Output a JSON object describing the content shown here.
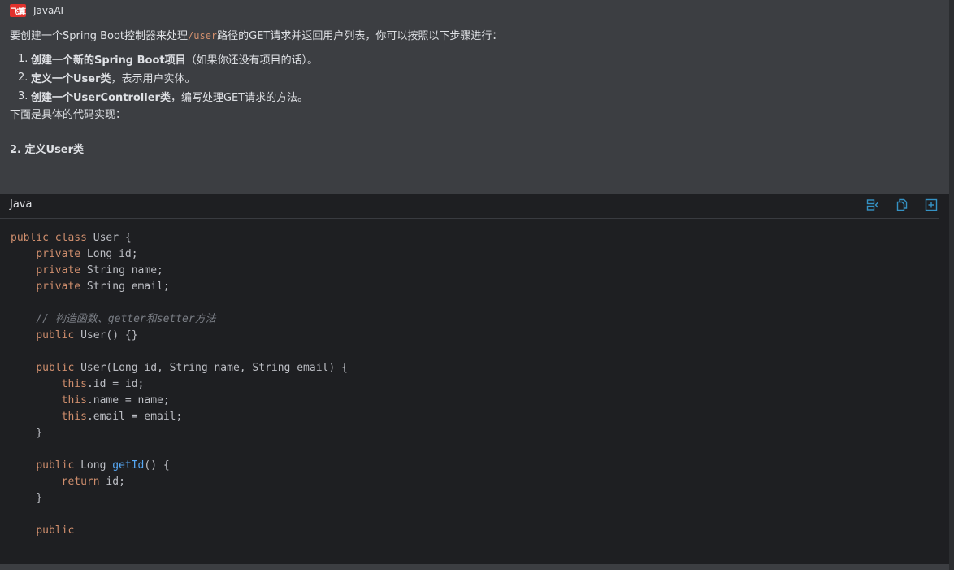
{
  "header": {
    "logo_text": "飞算",
    "app_name": "JavaAI"
  },
  "message": {
    "intro_before": "要创建一个Spring Boot控制器来处理",
    "intro_code": "/user",
    "intro_after": "路径的GET请求并返回用户列表，你可以按照以下步骤进行：",
    "steps": [
      {
        "num": "1.",
        "bold": "创建一个新的Spring Boot项目",
        "rest": "（如果你还没有项目的话）。"
      },
      {
        "num": "2.",
        "bold": "定义一个User类",
        "rest": "，表示用户实体。"
      },
      {
        "num": "3.",
        "bold": "创建一个UserController类",
        "rest": "，编写处理GET请求的方法。"
      }
    ],
    "outro": "下面是具体的代码实现：",
    "section_heading": "2. 定义User类"
  },
  "code_block": {
    "language": "Java",
    "toolbar_icons": [
      "insert-code-icon",
      "copy-icon",
      "new-file-icon"
    ],
    "lines": [
      [
        [
          "kw",
          "public"
        ],
        [
          "t",
          " "
        ],
        [
          "kw",
          "class"
        ],
        [
          "t",
          " User {"
        ]
      ],
      [
        [
          "t",
          "    "
        ],
        [
          "kw",
          "private"
        ],
        [
          "t",
          " Long id;"
        ]
      ],
      [
        [
          "t",
          "    "
        ],
        [
          "kw",
          "private"
        ],
        [
          "t",
          " String name;"
        ]
      ],
      [
        [
          "t",
          "    "
        ],
        [
          "kw",
          "private"
        ],
        [
          "t",
          " String email;"
        ]
      ],
      [],
      [
        [
          "t",
          "    "
        ],
        [
          "cm",
          "// 构造函数、getter和setter方法"
        ]
      ],
      [
        [
          "t",
          "    "
        ],
        [
          "kw",
          "public"
        ],
        [
          "t",
          " User() {}"
        ]
      ],
      [],
      [
        [
          "t",
          "    "
        ],
        [
          "kw",
          "public"
        ],
        [
          "t",
          " User(Long id, String name, String email) {"
        ]
      ],
      [
        [
          "t",
          "        "
        ],
        [
          "kw",
          "this"
        ],
        [
          "t",
          ".id = id;"
        ]
      ],
      [
        [
          "t",
          "        "
        ],
        [
          "kw",
          "this"
        ],
        [
          "t",
          ".name = name;"
        ]
      ],
      [
        [
          "t",
          "        "
        ],
        [
          "kw",
          "this"
        ],
        [
          "t",
          ".email = email;"
        ]
      ],
      [
        [
          "t",
          "    }"
        ]
      ],
      [],
      [
        [
          "t",
          "    "
        ],
        [
          "kw",
          "public"
        ],
        [
          "t",
          " Long "
        ],
        [
          "fn",
          "getId"
        ],
        [
          "t",
          "() {"
        ]
      ],
      [
        [
          "t",
          "        "
        ],
        [
          "kw",
          "return"
        ],
        [
          "t",
          " id;"
        ]
      ],
      [
        [
          "t",
          "    }"
        ]
      ],
      [],
      [
        [
          "t",
          "    "
        ],
        [
          "kw",
          "public"
        ]
      ]
    ]
  },
  "colors": {
    "chat_bg": "#3c3e42",
    "code_bg": "#1e1f22",
    "keyword": "#cf8e6d",
    "function": "#56a8f5",
    "comment": "#7a7e85",
    "icon_accent": "#3592c4",
    "logo_red": "#e1322d"
  }
}
